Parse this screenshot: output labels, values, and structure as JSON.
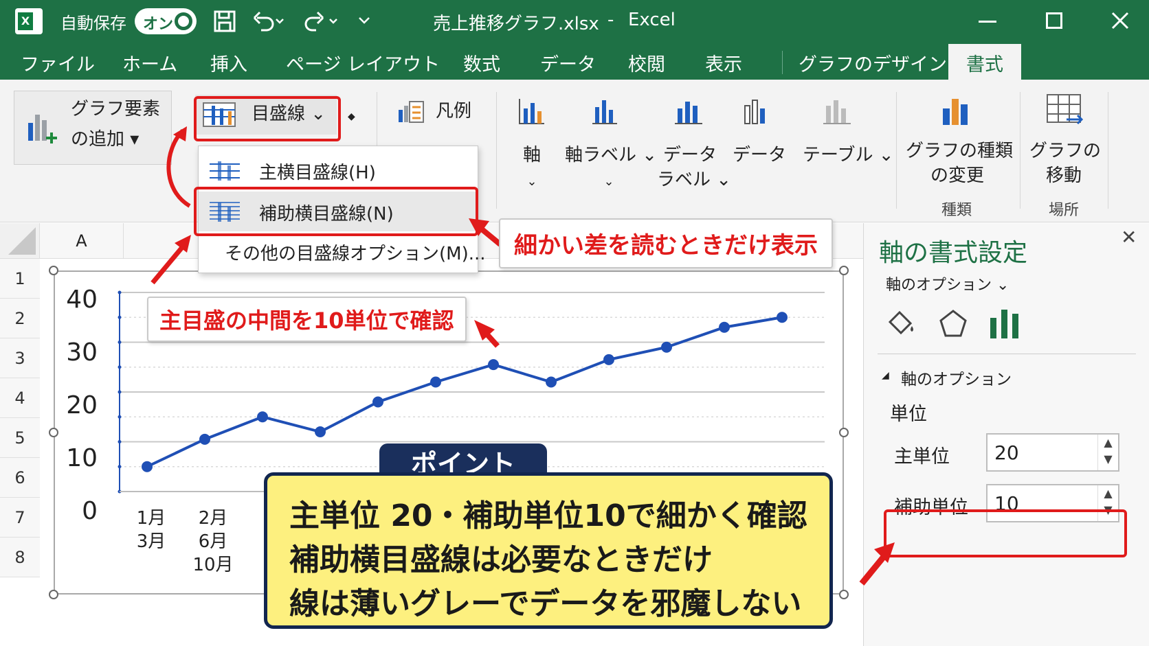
{
  "titlebar": {
    "autosave_label": "自動保存",
    "autosave_state": "オン",
    "filename": "売上推移グラフ.xlsx",
    "separator": "-",
    "app": "Excel"
  },
  "tabs": [
    "ファイル",
    "ホーム",
    "挿入",
    "ページ レイアウト",
    "数式",
    "データ",
    "校閲",
    "表示",
    "グラフのデザイン",
    "書式"
  ],
  "ribbon": {
    "add_element": [
      "グラフ要素",
      "の追加 ▾"
    ],
    "gridlines": "目盛線 ⌄",
    "legend": "凡例",
    "axis": "軸",
    "axis_label": "軸ラベル ⌄",
    "data_label": [
      "データ",
      "ラベル ⌄"
    ],
    "data": "データ",
    "table": "テーブル ⌄",
    "change_type": [
      "グラフの種類",
      "の変更"
    ],
    "move": [
      "グラフの",
      "移動"
    ],
    "group_type": "種類",
    "group_location": "場所"
  },
  "dropdown": {
    "items": [
      "主横目盛線(H)",
      "補助横目盛線(N)",
      "その他の目盛線オプション(M)..."
    ]
  },
  "sheet": {
    "col_header": "A",
    "rows": [
      "1",
      "2",
      "3",
      "4",
      "5",
      "6",
      "7",
      "8"
    ]
  },
  "chart_data": {
    "type": "line",
    "series": [
      {
        "values": [
          5,
          10.5,
          15,
          12,
          18,
          22,
          25.5,
          22,
          26.5,
          29,
          33,
          35
        ]
      }
    ],
    "y_ticks": [
      "40",
      "30",
      "20",
      "10",
      "0"
    ],
    "ylim": [
      0,
      40
    ],
    "x_labels": [
      "1月\n3月",
      "2月\n6月\n10月"
    ],
    "major_unit": 10,
    "minor_unit": 5,
    "grid": true,
    "line_color": "#1f4fb5"
  },
  "pane": {
    "title": "軸の書式設定",
    "options_dropdown": "軸のオプション ⌄",
    "section": "軸のオプション",
    "units_label": "単位",
    "major_label": "主単位",
    "major_value": "20",
    "minor_label": "補助単位",
    "minor_value": "10",
    "close": "✕"
  },
  "callouts": {
    "minor_note": "細かい差を読むときだけ表示",
    "mid_note": "主目盛の中間を10単位で確認"
  },
  "point": {
    "tag": "ポイント",
    "lines": [
      "主単位 20・補助単位10で細かく確認",
      "補助横目盛線は必要なときだけ",
      "線は薄いグレーでデータを邪魔しない"
    ]
  },
  "colors": {
    "excel_green": "#1e7145",
    "accent_red": "#e01b1b",
    "note_yellow": "#fdf07f",
    "navy": "#12264f"
  }
}
